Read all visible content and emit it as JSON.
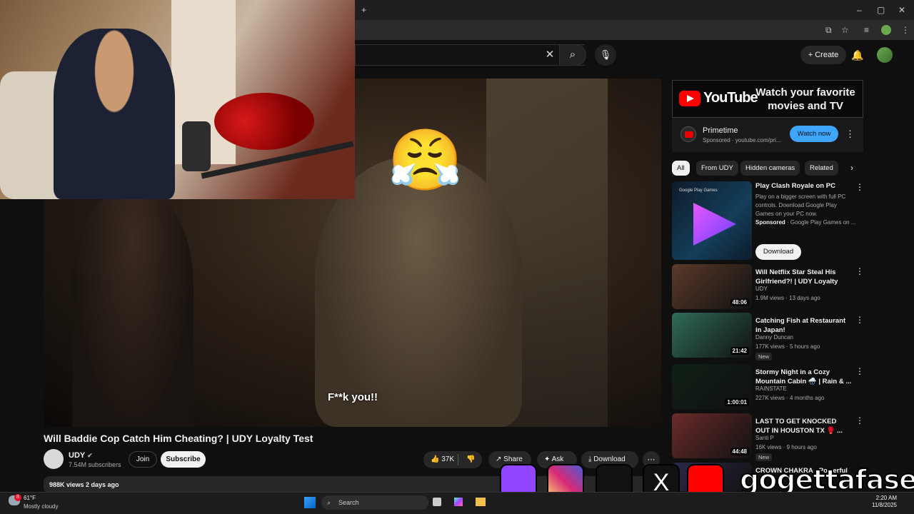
{
  "browser": {
    "new_tab": "+",
    "icons": [
      "minimize-icon",
      "maximize-icon",
      "close-icon",
      "install-icon",
      "star-icon",
      "media-icon",
      "profile-icon",
      "menu-icon"
    ]
  },
  "header": {
    "create_label": "Create",
    "search_icon": "search-icon",
    "mic_icon": "mic-icon",
    "bell_icon": "bell-icon"
  },
  "video": {
    "subtitle": "F**k you!!",
    "emoji": "😤",
    "title": "Will Baddie Cop Catch Him Cheating? | UDY Loyalty Test",
    "channel": "UDY",
    "subscribers": "7.54M subscribers",
    "join_label": "Join",
    "subscribe_label": "Subscribe",
    "likes": "37K",
    "share_label": "Share",
    "ask_label": "Ask",
    "download_label": "Download",
    "views_date": "988K views  2 days ago"
  },
  "ad": {
    "brand": "YouTube",
    "tagline": "Watch your favorite movies and TV",
    "name": "Primetime",
    "meta": "Sponsored · youtube.com/pri...",
    "cta": "Watch now"
  },
  "chips": [
    "All",
    "From UDY",
    "Hidden cameras",
    "Related"
  ],
  "sponsored_rec": {
    "title": "Play Clash Royale on PC",
    "brand_text": "Google Play Games",
    "description": "Play on a bigger screen with full PC controls. Download Google Play Games on your PC now.",
    "sponsored_label": "Sponsored",
    "sponsored_by": " · Google Play Games on ...",
    "cta": "Download"
  },
  "recommendations": [
    {
      "title": "Will Netflix Star Steal His Girlfriend?! | UDY Loyalty Test",
      "channel": "UDY",
      "meta": "1.9M views · 13 days ago",
      "duration": "48:06",
      "badge": "",
      "color": "#5a3a2a"
    },
    {
      "title": "Catching Fish at Restaurant in Japan!",
      "channel": "Danny Duncan",
      "meta": "177K views · 5 hours ago",
      "duration": "21:42",
      "badge": "New",
      "color": "#2f6b5a"
    },
    {
      "title": "Stormy Night in a Cozy Mountain Cabin 🌧️ | Rain & ...",
      "channel": "RAINSTATE",
      "meta": "227K views · 4 months ago",
      "duration": "1:00:01",
      "badge": "",
      "color": "#0f1f15"
    },
    {
      "title": "LAST TO GET KNOCKED OUT IN HOUSTON TX 🥊 ...",
      "channel": "Santi P",
      "meta": "16K views · 9 hours ago",
      "duration": "44:48",
      "badge": "New",
      "color": "#6b2b2b"
    },
    {
      "title": "CROWN CHAKRA · Powerful",
      "channel": "",
      "meta": "",
      "duration": "",
      "badge": "",
      "color": "#2a2a4a"
    }
  ],
  "social": {
    "handle": "gogettafase",
    "colors": {
      "twitch": "#9146ff",
      "instagram": "#d62976",
      "tiktok": "#111111",
      "x": "#111111",
      "youtube": "#ff0000"
    }
  },
  "taskbar": {
    "weather_temp": "61°F",
    "weather_desc": "Mostly cloudy",
    "search_placeholder": "Search",
    "time": "2:20 AM",
    "date": "11/8/2025",
    "notification_count": "8"
  }
}
